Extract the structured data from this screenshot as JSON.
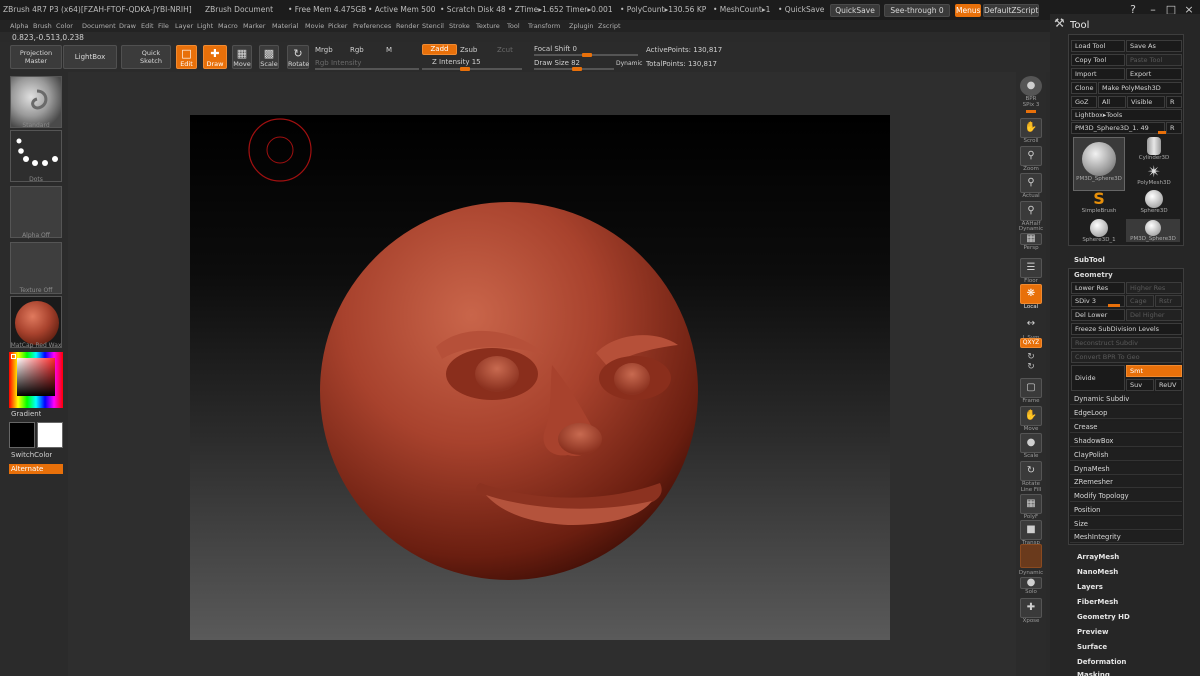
{
  "titlebar": {
    "app_title": "ZBrush 4R7 P3 (x64)[FZAH-FTOF-QDKA-JYBI-NRIH]",
    "document": "ZBrush Document",
    "free_mem": "• Free Mem 4.475GB",
    "active_mem": "• Active Mem 500",
    "scratch_disk": "• Scratch Disk 48",
    "ztime": "• ZTime▸1.652 Timer▸0.001",
    "polycount": "• PolyCount▸130.56 KP",
    "meshcount": "• MeshCount▸1",
    "quicksave_label": "• QuickSave",
    "quicksave_button": "QuickSave",
    "see_through": "See-through  0",
    "menus": "Menus",
    "script": "DefaultZScript"
  },
  "menubar": [
    "Alpha",
    "Brush",
    "Color",
    "Document",
    "Draw",
    "Edit",
    "File",
    "Layer",
    "Light",
    "Macro",
    "Marker",
    "Material",
    "Movie",
    "Picker",
    "Preferences",
    "Render",
    "Stencil",
    "Stroke",
    "Texture",
    "Tool",
    "Transform",
    "Zplugin",
    "Zscript"
  ],
  "coords": "0.823,-0.513,0.238",
  "toolbar": {
    "projection_master": [
      "Projection",
      "Master"
    ],
    "lightbox": "LightBox",
    "quick_sketch": [
      "Quick",
      "Sketch"
    ],
    "edit": "Edit",
    "draw": "Draw",
    "move": "Move",
    "scale": "Scale",
    "rotate": "Rotate",
    "mrgb": "Mrgb",
    "rgb": "Rgb",
    "m": "M",
    "rgb_intensity": "Rgb Intensity",
    "zadd": "Zadd",
    "zsub": "Zsub",
    "zcut": "Zcut",
    "z_intensity": "Z Intensity 15",
    "focal_shift": "Focal Shift 0",
    "draw_size": "Draw Size 82",
    "dynamic": "Dynamic",
    "active_points": "ActivePoints: 130,817",
    "total_points": "TotalPoints: 130,817"
  },
  "leftpanel": {
    "brush": "Standard",
    "stroke": "Dots",
    "alpha": "Alpha  Off",
    "texture": "Texture  Off",
    "material": "MatCap Red Wax",
    "gradient": "Gradient",
    "switch_color": "SwitchColor",
    "alternate": "Alternate"
  },
  "rightshelf": {
    "bpr": "BPR",
    "spix": "SPix 3",
    "scroll": "Scroll",
    "zoom": "Zoom",
    "actual": "Actual",
    "aahalf": "AAHalf",
    "dynamic": "Dynamic",
    "persp": "Persp",
    "floor": "Floor",
    "local": "Local",
    "lsym": "L.Sym",
    "xyz": "QXYZ",
    "frame": "Frame",
    "move": "Move",
    "scale": "Scale",
    "rotate": "Rotate",
    "line_fill": "Line Fill",
    "polyf": "PolyF",
    "transp": "Transp",
    "dynamic2": "Dynamic",
    "solo": "Solo",
    "xpose": "Xpose"
  },
  "toolpanel": {
    "title": "Tool",
    "load_tool": "Load Tool",
    "save_as": "Save As",
    "copy_tool": "Copy Tool",
    "paste_tool": "Paste Tool",
    "import": "Import",
    "export": "Export",
    "clone": "Clone",
    "make_polymesh": "Make PolyMesh3D",
    "goz": "GoZ",
    "all": "All",
    "visible": "Visible",
    "r": "R",
    "lightbox_tools": "Lightbox▸Tools",
    "current_tool": "PM3D_Sphere3D_1. 49",
    "r2": "R",
    "tools": [
      {
        "name": "PM3D_Sphere3D",
        "icon": "face-sphere-icon"
      },
      {
        "name": "Cylinder3D",
        "icon": "cylinder-icon"
      },
      {
        "name": "PolyMesh3D",
        "icon": "star-icon"
      },
      {
        "name": "SimpleBrush",
        "icon": "simplebrush-icon"
      },
      {
        "name": "Sphere3D",
        "icon": "sphere-icon"
      },
      {
        "name": "Sphere3D_1",
        "icon": "sphere-icon"
      },
      {
        "name": "PM3D_Sphere3D",
        "icon": "sphere-icon"
      }
    ],
    "subtool": "SubTool",
    "geometry": "Geometry",
    "lower_res": "Lower Res",
    "higher_res": "Higher Res",
    "sdiv": "SDiv 3",
    "cage": "Cage",
    "rstr": "Rstr",
    "del_lower": "Del Lower",
    "del_higher": "Del Higher",
    "freeze_subdiv": "Freeze SubDivision Levels",
    "reconstruct_subdiv": "Reconstruct Subdiv",
    "convert_bpr": "Convert BPR To Geo",
    "divide": "Divide",
    "smt": "Smt",
    "suv": "Suv",
    "reuv": "ReUV",
    "geo_items": [
      "Dynamic Subdiv",
      "EdgeLoop",
      "Crease",
      "ShadowBox",
      "ClayPolish",
      "DynaMesh",
      "ZRemesher",
      "Modify Topology",
      "Position",
      "Size",
      "MeshIntegrity"
    ],
    "sections": [
      "ArrayMesh",
      "NanoMesh",
      "Layers",
      "FiberMesh",
      "Geometry HD",
      "Preview",
      "Surface",
      "Deformation",
      "Masking"
    ]
  },
  "colors": {
    "accent": "#e8700a",
    "clay": "#a8422d",
    "primary_color": "#000000",
    "secondary_color": "#ffffff"
  }
}
